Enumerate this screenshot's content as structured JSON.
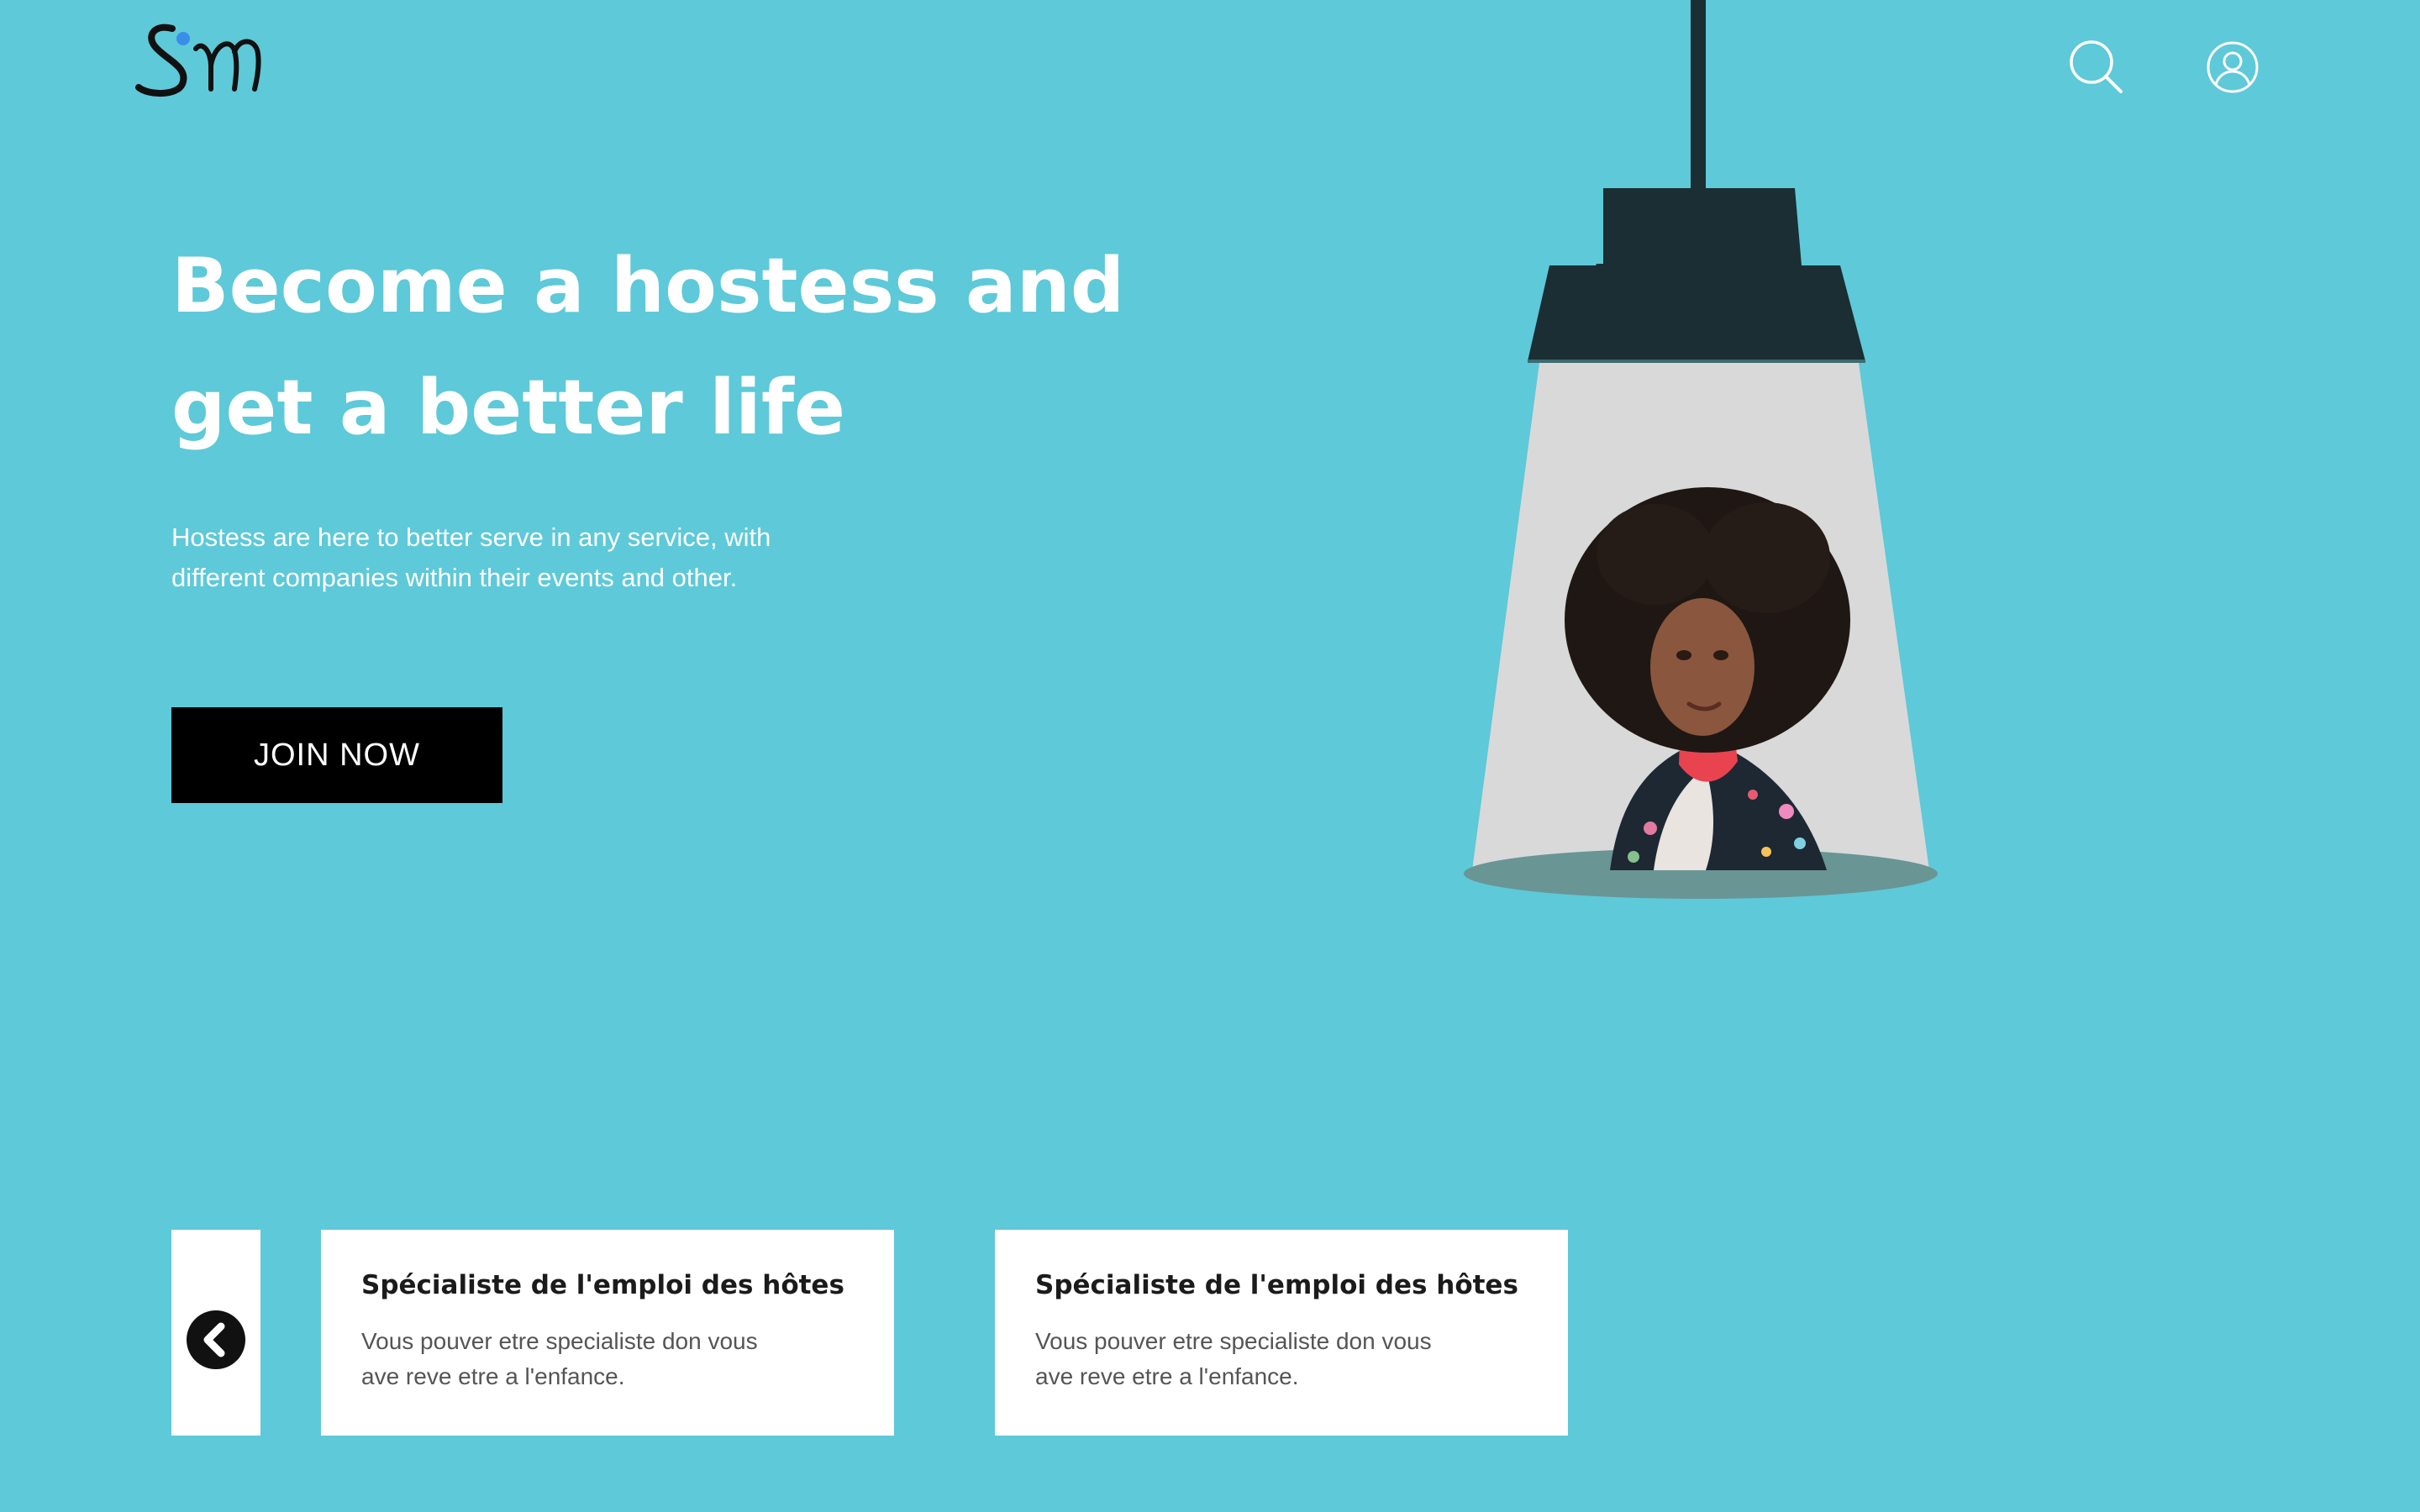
{
  "header": {
    "logo_icon": "sm-script-logo-icon",
    "search_icon": "search-icon",
    "user_icon": "user-profile-icon"
  },
  "hero": {
    "title_line1": "Become a hostess and",
    "title_line2": "get a better life",
    "description_line1": "Hostess are here to better serve in any service, with",
    "description_line2": "different companies within their events and other.",
    "cta_label": "JOIN NOW"
  },
  "illustration": {
    "lamp_icon": "hanging-lamp-icon",
    "portrait": "woman-portrait-photo"
  },
  "carousel": {
    "prev_icon": "chevron-left-icon",
    "cards": [
      {
        "title": "Spécialiste de l'emploi des hôtes",
        "text_line1": "Vous pouver etre specialiste don vous",
        "text_line2": "ave reve etre a l'enfance."
      },
      {
        "title": "Spécialiste de l'emploi des hôtes",
        "text_line1": "Vous pouver etre specialiste don vous",
        "text_line2": "ave reve etre a l'enfance."
      }
    ]
  },
  "colors": {
    "background": "#5ec9d8",
    "lamp_dark": "#1a2e33",
    "light_cone": "#d9d9d9",
    "button_bg": "#000000",
    "logo_dot": "#3b8ee8"
  }
}
